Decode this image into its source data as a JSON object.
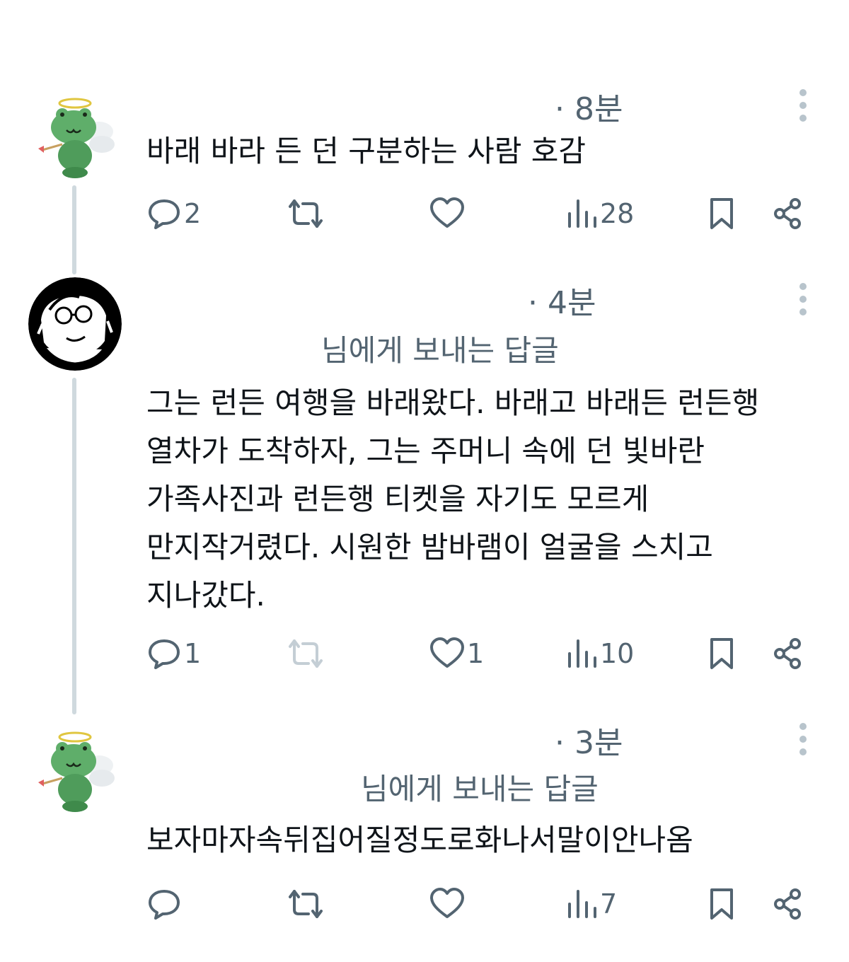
{
  "replies": [
    {
      "time": "· 8분",
      "reply_to": "",
      "text_lines": [
        "바래 바라 든 던 구분하는 사람 호감"
      ],
      "actions": {
        "replies": "2",
        "reposts": "",
        "likes": "",
        "views": "28"
      }
    },
    {
      "time": "· 4분",
      "reply_to": "님에게 보내는 답글",
      "text_lines": [
        "그는 런든 여행을 바래왔다. 바래고 바래든 런든행",
        "열차가 도착하자, 그는 주머니 속에 던 빛바란",
        "가족사진과 런든행 티켓을 자기도 모르게",
        "만지작거렸다. 시원한 밤바램이 얼굴을 스치고",
        "지나갔다."
      ],
      "actions": {
        "replies": "1",
        "reposts": "",
        "likes": "1",
        "views": "10"
      }
    },
    {
      "time": "· 3분",
      "reply_to": "님에게 보내는 답글",
      "text_lines": [
        "보자마자속뒤집어질정도로화나서말이안나옴"
      ],
      "actions": {
        "replies": "",
        "reposts": "",
        "likes": "",
        "views": "7"
      }
    }
  ],
  "icons": {
    "reply": "speech-bubble-icon",
    "repost": "repost-arrows-icon",
    "like": "heart-icon",
    "views": "bar-chart-icon",
    "bookmark": "bookmark-icon",
    "share": "share-icon",
    "more": "vertical-dots-icon"
  },
  "colors": {
    "text": "#0f1419",
    "muted": "#536471",
    "line": "#cfd9de",
    "frog": "#5fae6a"
  }
}
